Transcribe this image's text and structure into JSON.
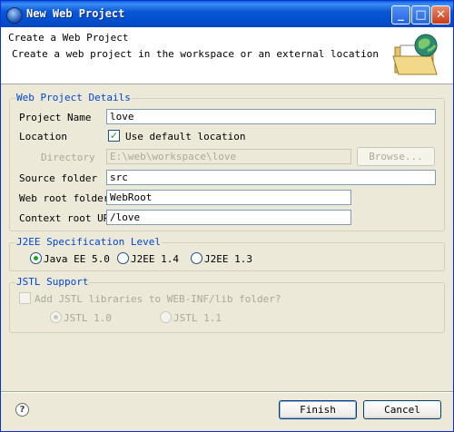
{
  "window": {
    "title": "New Web Project"
  },
  "header": {
    "title": "Create a Web Project",
    "description": "Create a web project in the workspace or an external location"
  },
  "details": {
    "legend": "Web Project Details",
    "project_name_label": "Project Name",
    "project_name_value": "love",
    "location_label": "Location",
    "use_default_label": "Use default location",
    "use_default_checked": true,
    "directory_label": "Directory",
    "directory_value": "E:\\web\\workspace\\love",
    "browse_label": "Browse...",
    "source_folder_label": "Source folder",
    "source_folder_value": "src",
    "web_root_label": "Web root folder",
    "web_root_value": "WebRoot",
    "context_root_label": "Context root URL",
    "context_root_value": "/love"
  },
  "j2ee": {
    "legend": "J2EE Specification Level",
    "options": [
      "Java EE 5.0",
      "J2EE 1.4",
      "J2EE 1.3"
    ],
    "selected": "Java EE 5.0"
  },
  "jstl": {
    "legend": "JSTL Support",
    "add_label": "Add JSTL libraries to WEB-INF/lib folder?",
    "options": [
      "JSTL 1.0",
      "JSTL 1.1"
    ],
    "selected": "JSTL 1.0"
  },
  "footer": {
    "finish_label": "Finish",
    "cancel_label": "Cancel"
  },
  "colors": {
    "title_bar": "#0a58d6",
    "group_legend": "#0046d5",
    "dialog_bg": "#ece9d8",
    "check_green": "#21a121"
  },
  "icons": [
    "app-icon",
    "minimize-icon",
    "maximize-icon",
    "close-icon",
    "web-project-icon",
    "help-icon"
  ]
}
